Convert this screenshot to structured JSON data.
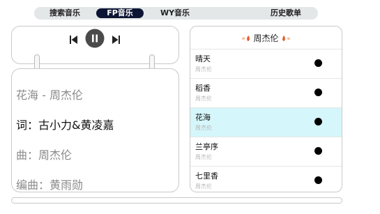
{
  "tabs": [
    {
      "label": "搜索音乐",
      "active": false
    },
    {
      "label": "FP音乐",
      "active": true
    },
    {
      "label": "WY音乐",
      "active": false
    },
    {
      "label": "历史歌单",
      "active": false
    }
  ],
  "player": {
    "prev_icon": "skip-previous-icon",
    "play_icon": "pause-icon",
    "next_icon": "skip-next-icon"
  },
  "lyrics": [
    "花海 - 周杰伦",
    "词：古小力&黄凌嘉",
    "曲：周杰伦",
    "编曲：黄雨勋"
  ],
  "playlist": {
    "title": "周杰伦",
    "title_icon": "fire-icon",
    "songs": [
      {
        "name": "晴天",
        "artist": "周杰伦"
      },
      {
        "name": "稻香",
        "artist": "周杰伦"
      },
      {
        "name": "花海",
        "artist": "周杰伦",
        "active": true
      },
      {
        "name": "兰亭序",
        "artist": "周杰伦"
      },
      {
        "name": "七里香",
        "artist": "周杰伦"
      }
    ]
  },
  "progress": {
    "value": 0.0
  },
  "colors": {
    "active_tab_bg": "#0c1533",
    "tabbar_bg": "#e3e7e8",
    "active_row_bg": "#d5f6fa",
    "play_button": "#4a4a4a"
  }
}
